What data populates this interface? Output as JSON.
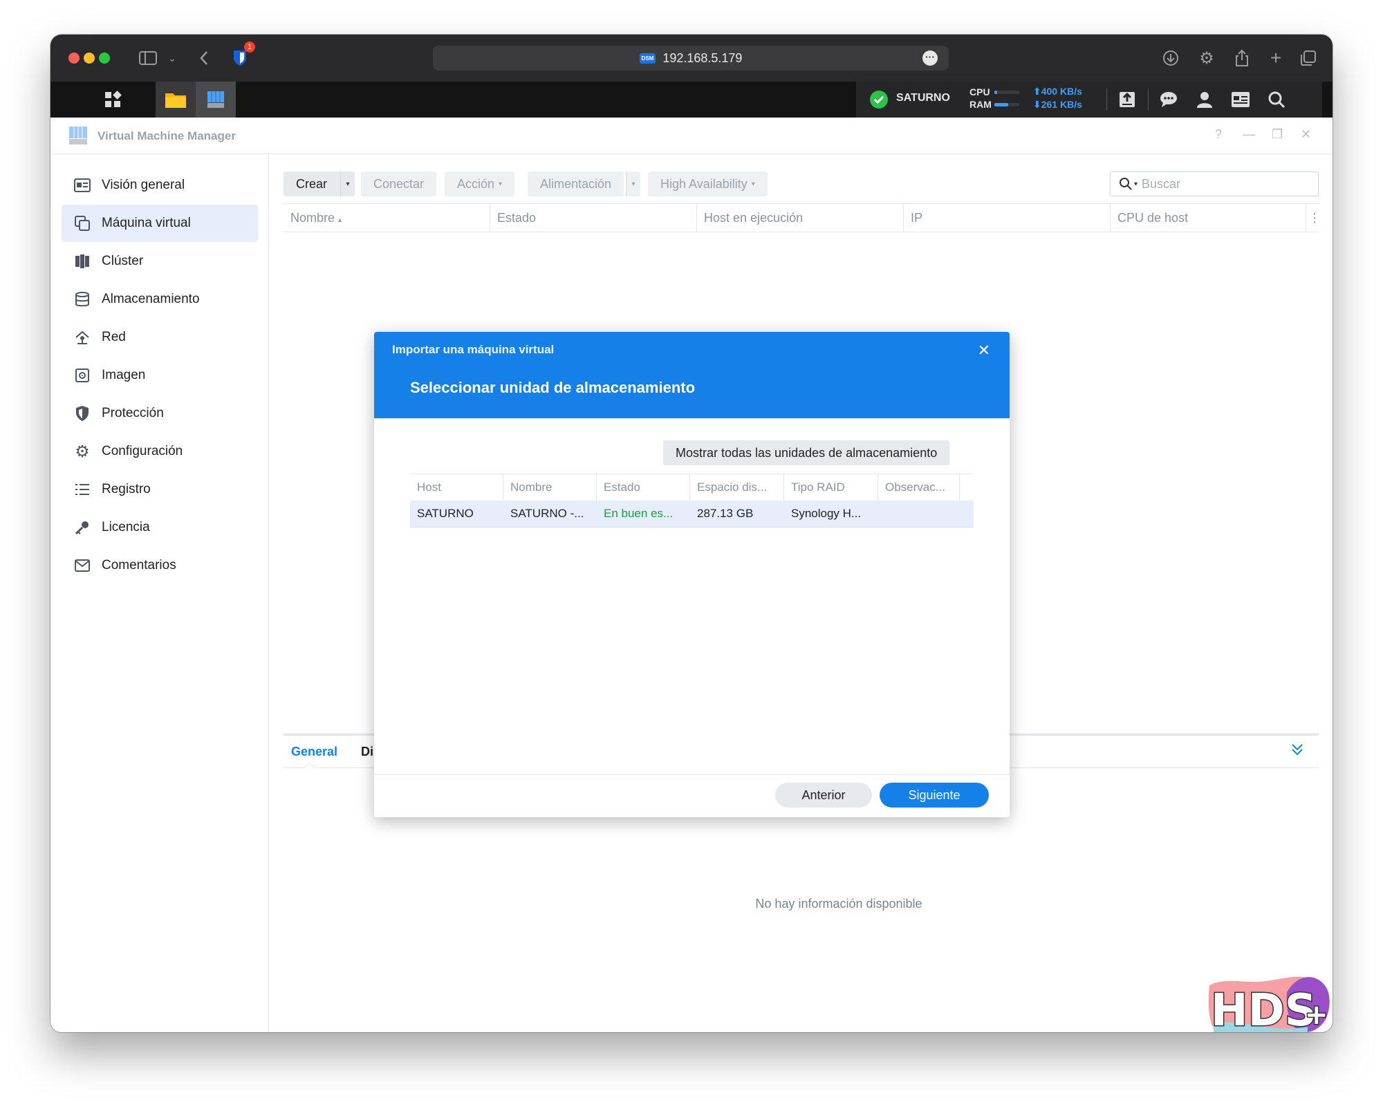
{
  "browser": {
    "url": "192.168.5.179",
    "badge_count": "1",
    "favicon_label": "DSM"
  },
  "dsm_tray": {
    "server_name": "SATURNO",
    "cpu_label": "CPU",
    "ram_label": "RAM",
    "cpu_usage": 0.1,
    "ram_usage": 0.55,
    "upload": "400 KB/s",
    "download": "261 KB/s"
  },
  "app": {
    "title": "Virtual Machine Manager",
    "help": "?"
  },
  "sidebar": {
    "items": [
      {
        "label": "Visión general",
        "icon": "overview-icon",
        "active": false
      },
      {
        "label": "Máquina virtual",
        "icon": "virtual-machine-icon",
        "active": true
      },
      {
        "label": "Clúster",
        "icon": "cluster-icon",
        "active": false
      },
      {
        "label": "Almacenamiento",
        "icon": "storage-icon",
        "active": false
      },
      {
        "label": "Red",
        "icon": "network-icon",
        "active": false
      },
      {
        "label": "Imagen",
        "icon": "image-icon",
        "active": false
      },
      {
        "label": "Protección",
        "icon": "shield-icon",
        "active": false
      },
      {
        "label": "Configuración",
        "icon": "gear-icon",
        "active": false
      },
      {
        "label": "Registro",
        "icon": "list-icon",
        "active": false
      },
      {
        "label": "Licencia",
        "icon": "key-icon",
        "active": false
      },
      {
        "label": "Comentarios",
        "icon": "mail-icon",
        "active": false
      }
    ]
  },
  "toolbar": {
    "create": "Crear",
    "connect": "Conectar",
    "action": "Acción",
    "power": "Alimentación",
    "ha": "High Availability",
    "search_placeholder": "Buscar"
  },
  "grid": {
    "columns": [
      "Nombre",
      "Estado",
      "Host en ejecución",
      "IP",
      "CPU de host"
    ]
  },
  "details": {
    "tab_general": "General",
    "tab_second": "Di",
    "no_info": "No hay información disponible"
  },
  "dialog": {
    "subtitle": "Importar una máquina virtual",
    "title": "Seleccionar unidad de almacenamiento",
    "show_all": "Mostrar todas las unidades de almacenamiento",
    "columns": [
      "Host",
      "Nombre",
      "Estado",
      "Espacio dis...",
      "Tipo RAID",
      "Observac..."
    ],
    "rows": [
      {
        "host": "SATURNO",
        "name": "SATURNO -...",
        "status": "En buen es...",
        "space": "287.13 GB",
        "raid": "Synology H...",
        "notes": ""
      }
    ],
    "status_color": "#1a9c3a",
    "back": "Anterior",
    "next": "Siguiente"
  },
  "watermark": {
    "text": "HDS+"
  },
  "colors": {
    "accent": "#1680e9",
    "active_nav": "#e6eefb"
  }
}
